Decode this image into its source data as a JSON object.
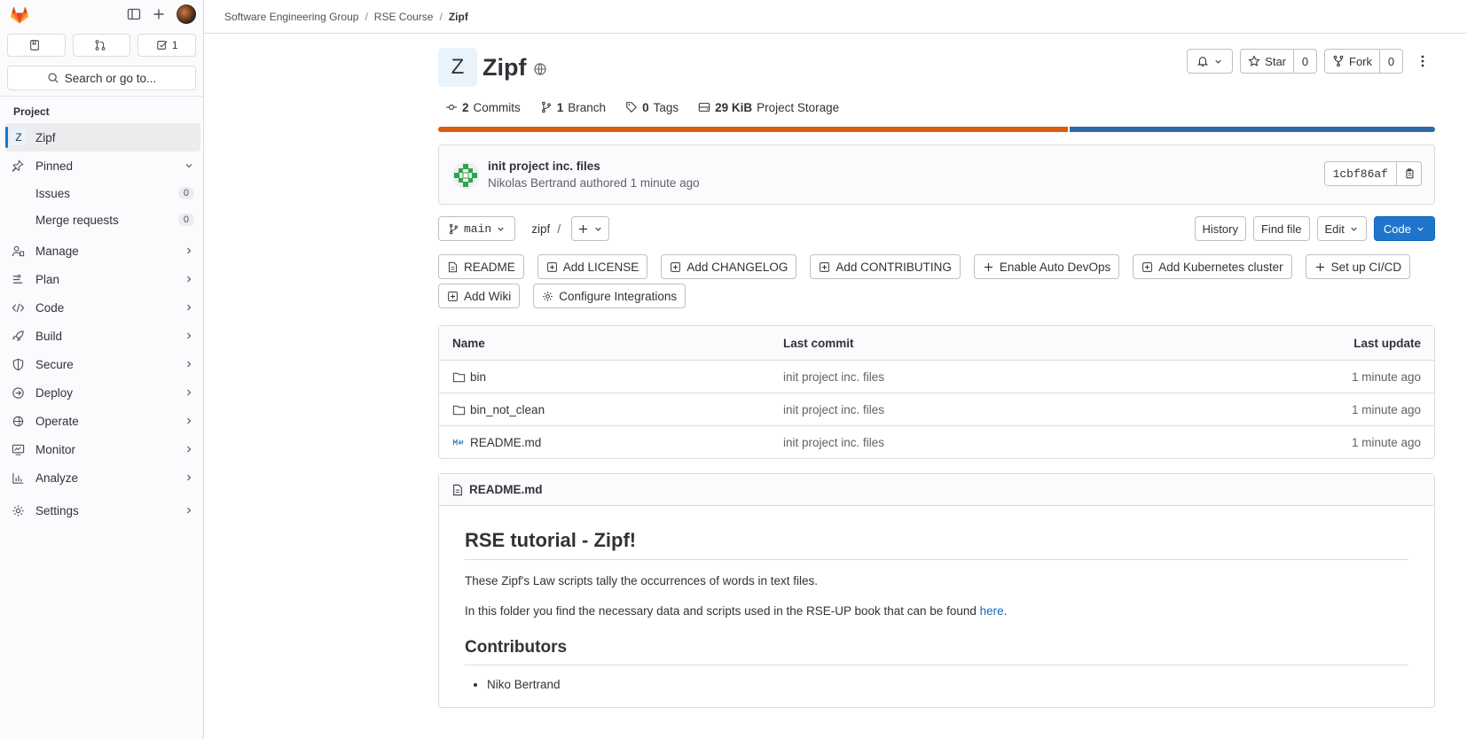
{
  "breadcrumb": [
    "Software Engineering Group",
    "RSE Course",
    "Zipf"
  ],
  "sidebar": {
    "counts": {
      "issues": "",
      "merge_requests": "",
      "todos": "1"
    },
    "search_label": "Search or go to...",
    "section_label": "Project",
    "project_item": {
      "avatar_letter": "Z",
      "label": "Zipf"
    },
    "pinned": {
      "label": "Pinned",
      "items": [
        {
          "label": "Issues",
          "count": "0"
        },
        {
          "label": "Merge requests",
          "count": "0"
        }
      ]
    },
    "nav": [
      "Manage",
      "Plan",
      "Code",
      "Build",
      "Secure",
      "Deploy",
      "Operate",
      "Monitor",
      "Analyze"
    ],
    "settings": "Settings"
  },
  "project": {
    "avatar_letter": "Z",
    "name": "Zipf",
    "star_label": "Star",
    "star_count": "0",
    "fork_label": "Fork",
    "fork_count": "0",
    "stats": {
      "commits_n": "2",
      "commits_label": "Commits",
      "branch_n": "1",
      "branch_label": "Branch",
      "tags_n": "0",
      "tags_label": "Tags",
      "storage_n": "29 KiB",
      "storage_label": "Project Storage"
    },
    "storage_fraction_first": 0.632,
    "colors": {
      "storage_primary": "#dd5b0c",
      "storage_secondary": "#2f6aa5",
      "accent": "#1f75cb"
    }
  },
  "commit": {
    "title": "init project inc. files",
    "author": "Nikolas Bertrand",
    "action": "authored",
    "time": "1 minute ago",
    "sha": "1cbf86af"
  },
  "repo": {
    "branch": "main",
    "path": "zipf",
    "buttons": {
      "history": "History",
      "find_file": "Find file",
      "edit": "Edit",
      "code": "Code"
    }
  },
  "shortcuts": [
    "README",
    "Add LICENSE",
    "Add CHANGELOG",
    "Add CONTRIBUTING",
    "Enable Auto DevOps",
    "Add Kubernetes cluster",
    "Set up CI/CD",
    "Add Wiki",
    "Configure Integrations"
  ],
  "files": {
    "headers": {
      "name": "Name",
      "last_commit": "Last commit",
      "last_update": "Last update"
    },
    "rows": [
      {
        "name": "bin",
        "icon": "folder-icon",
        "commit": "init project inc. files",
        "updated": "1 minute ago"
      },
      {
        "name": "bin_not_clean",
        "icon": "folder-icon",
        "commit": "init project inc. files",
        "updated": "1 minute ago"
      },
      {
        "name": "README.md",
        "icon": "markdown-icon",
        "commit": "init project inc. files",
        "updated": "1 minute ago"
      }
    ]
  },
  "readme": {
    "filename": "README.md",
    "h1": "RSE tutorial - Zipf!",
    "p1": "These Zipf's Law scripts tally the occurrences of words in text files.",
    "p2_before": "In this folder you find the necessary data and scripts used in the RSE-UP book that can be found ",
    "p2_link": "here",
    "p2_after": ".",
    "h2": "Contributors",
    "contributors": [
      "Niko Bertrand"
    ]
  }
}
